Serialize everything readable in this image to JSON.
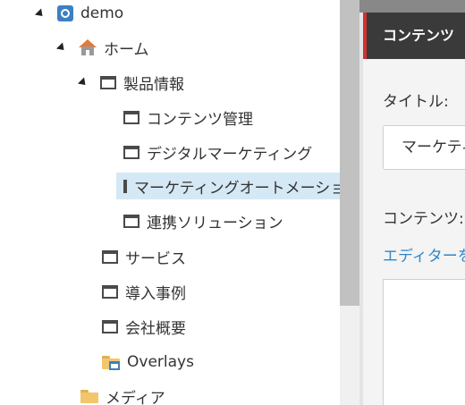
{
  "tree": {
    "items": [
      {
        "label": "demo",
        "icon": "site-globe-icon"
      },
      {
        "label": "ホーム",
        "icon": "home-icon"
      },
      {
        "label": "製品情報",
        "icon": "page-icon"
      },
      {
        "label": "コンテンツ管理",
        "icon": "page-icon"
      },
      {
        "label": "デジタルマーケティング",
        "icon": "page-icon"
      },
      {
        "label": "マーケティングオートメーション",
        "icon": "page-icon",
        "selected": true
      },
      {
        "label": "連携ソリューション",
        "icon": "page-icon"
      },
      {
        "label": "サービス",
        "icon": "page-icon"
      },
      {
        "label": "導入事例",
        "icon": "page-icon"
      },
      {
        "label": "会社概要",
        "icon": "page-icon"
      },
      {
        "label": "Overlays",
        "icon": "overlay-folder-icon"
      },
      {
        "label": "メディア",
        "icon": "folder-icon"
      }
    ]
  },
  "editor": {
    "header_title": "コンテンツ",
    "title_label": "タイトル:",
    "title_value": "マーケティングオートメーション",
    "content_label": "コンテンツ:",
    "editor_link": "エディターを開く"
  },
  "colors": {
    "selected_bg": "#d5e8f5",
    "accent_red": "#d0302f",
    "link_blue": "#2f86c8",
    "header_bg": "#3a3a3a"
  }
}
